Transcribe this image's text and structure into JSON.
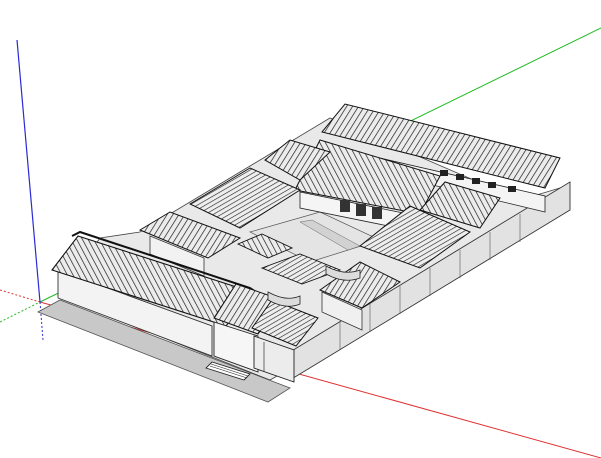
{
  "app": {
    "viewport": "3d-modeling-canvas",
    "model": "courtyard-house-siheyuan"
  },
  "colors": {
    "background": "#ffffff",
    "axis_red": "#e03030",
    "axis_green": "#22bb22",
    "axis_blue": "#2a2ad6",
    "ground": "#c8c8c8",
    "wall": "#f2f2f2",
    "wall_dark": "#d8d8d8",
    "roof": "#e6e6e6",
    "roof_line": "#1a1a1a",
    "court": "#e8e8e8"
  },
  "icons": {
    "origin_marker": "axis-origin-icon"
  }
}
